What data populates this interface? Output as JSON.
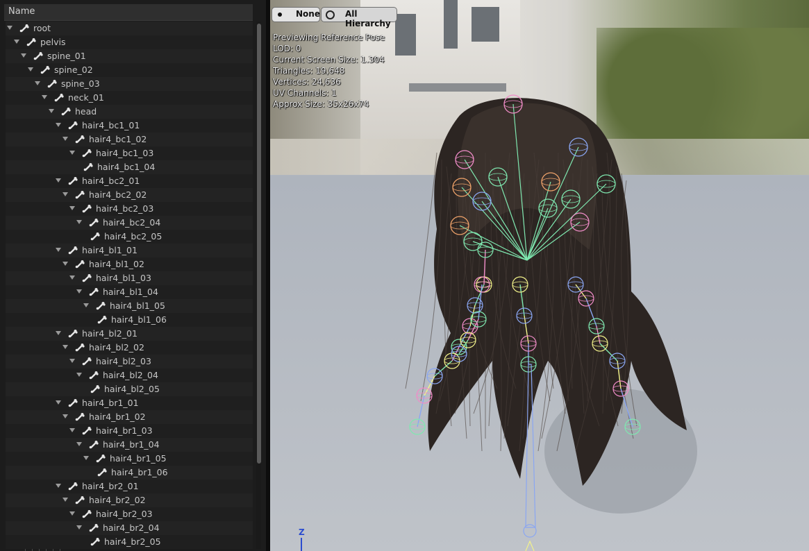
{
  "tree": {
    "header": "Name",
    "rows": [
      {
        "label": "root",
        "depth": 0
      },
      {
        "label": "pelvis",
        "depth": 1
      },
      {
        "label": "spine_01",
        "depth": 2
      },
      {
        "label": "spine_02",
        "depth": 3
      },
      {
        "label": "spine_03",
        "depth": 4
      },
      {
        "label": "neck_01",
        "depth": 5
      },
      {
        "label": "head",
        "depth": 6
      },
      {
        "label": "hair4_bc1_01",
        "depth": 7
      },
      {
        "label": "hair4_bc1_02",
        "depth": 8
      },
      {
        "label": "hair4_bc1_03",
        "depth": 9
      },
      {
        "label": "hair4_bc1_04",
        "depth": 10,
        "leaf": true
      },
      {
        "label": "hair4_bc2_01",
        "depth": 7
      },
      {
        "label": "hair4_bc2_02",
        "depth": 8
      },
      {
        "label": "hair4_bc2_03",
        "depth": 9
      },
      {
        "label": "hair4_bc2_04",
        "depth": 10
      },
      {
        "label": "hair4_bc2_05",
        "depth": 11,
        "leaf": true
      },
      {
        "label": "hair4_bl1_01",
        "depth": 7
      },
      {
        "label": "hair4_bl1_02",
        "depth": 8
      },
      {
        "label": "hair4_bl1_03",
        "depth": 9
      },
      {
        "label": "hair4_bl1_04",
        "depth": 10
      },
      {
        "label": "hair4_bl1_05",
        "depth": 11
      },
      {
        "label": "hair4_bl1_06",
        "depth": 12,
        "leaf": true
      },
      {
        "label": "hair4_bl2_01",
        "depth": 7
      },
      {
        "label": "hair4_bl2_02",
        "depth": 8
      },
      {
        "label": "hair4_bl2_03",
        "depth": 9
      },
      {
        "label": "hair4_bl2_04",
        "depth": 10
      },
      {
        "label": "hair4_bl2_05",
        "depth": 11,
        "leaf": true
      },
      {
        "label": "hair4_br1_01",
        "depth": 7
      },
      {
        "label": "hair4_br1_02",
        "depth": 8
      },
      {
        "label": "hair4_br1_03",
        "depth": 9
      },
      {
        "label": "hair4_br1_04",
        "depth": 10
      },
      {
        "label": "hair4_br1_05",
        "depth": 11
      },
      {
        "label": "hair4_br1_06",
        "depth": 12,
        "leaf": true
      },
      {
        "label": "hair4_br2_01",
        "depth": 7
      },
      {
        "label": "hair4_br2_02",
        "depth": 8
      },
      {
        "label": "hair4_br2_03",
        "depth": 9
      },
      {
        "label": "hair4_br2_04",
        "depth": 10
      },
      {
        "label": "hair4_br2_05",
        "depth": 11,
        "leaf": true
      }
    ],
    "icons": {
      "expand": "triangle-down-icon",
      "bone": "bone-icon"
    }
  },
  "viewport": {
    "buttons": {
      "none": "None",
      "all_hierarchy": "All Hierarchy"
    },
    "stats": [
      "Previewing Reference Pose",
      "LOD: 0",
      "Current Screen Size: 1.304",
      "Triangles: 19,648",
      "Vertices: 24,636",
      "UV Channels: 1",
      "Approx Size: 35x26x74"
    ],
    "axis_label": "Z",
    "colors": {
      "axis_z": "#2b4ccf",
      "bone_green": "#7fe8b0",
      "bone_pink": "#f08cc8",
      "bone_yellow": "#f2f28a",
      "bone_blue": "#8aa6f2",
      "bone_orange": "#f0a36a"
    }
  }
}
